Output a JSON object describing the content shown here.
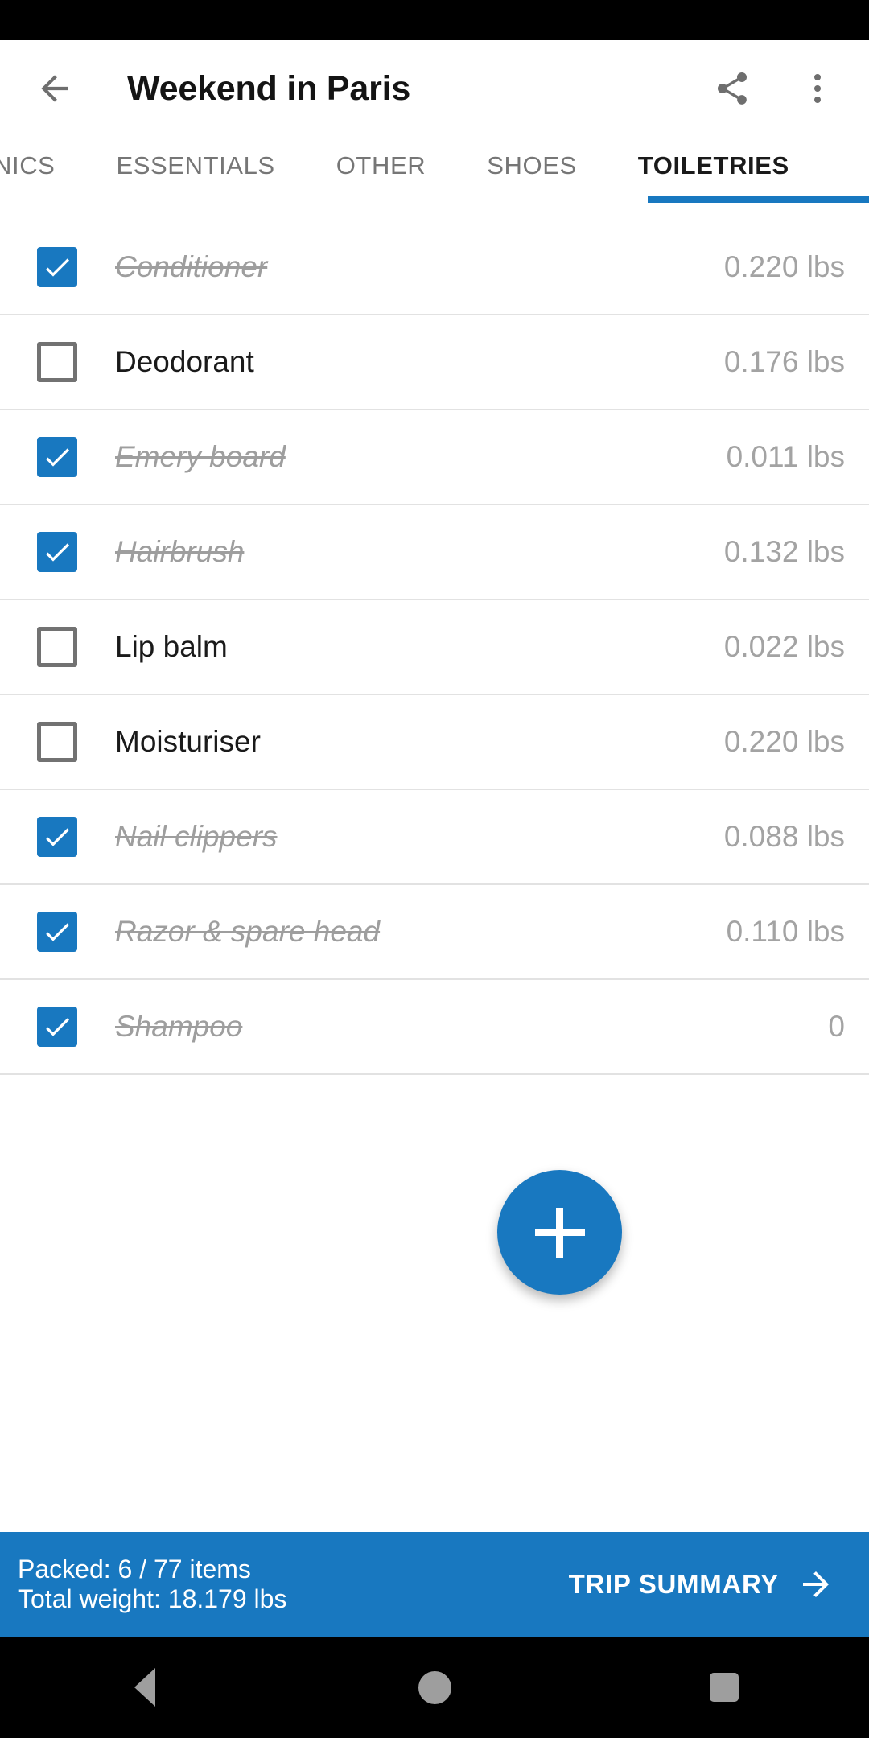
{
  "status_bar": {
    "background": "#000000"
  },
  "app_bar": {
    "back_icon": "arrow-left-icon",
    "title": "Weekend in Paris",
    "share_icon": "share-icon",
    "overflow_icon": "more-vertical-icon"
  },
  "tabs": {
    "items": [
      {
        "label": "NICS",
        "active": false
      },
      {
        "label": "ESSENTIALS",
        "active": false
      },
      {
        "label": "OTHER",
        "active": false
      },
      {
        "label": "SHOES",
        "active": false
      },
      {
        "label": "TOILETRIES",
        "active": true
      }
    ],
    "indicator_color": "#1878c0"
  },
  "list": {
    "items": [
      {
        "name": "Conditioner",
        "weight": "0.220 lbs",
        "packed": true
      },
      {
        "name": "Deodorant",
        "weight": "0.176 lbs",
        "packed": false
      },
      {
        "name": "Emery board",
        "weight": "0.011 lbs",
        "packed": true
      },
      {
        "name": "Hairbrush",
        "weight": "0.132 lbs",
        "packed": true
      },
      {
        "name": "Lip balm",
        "weight": "0.022 lbs",
        "packed": false
      },
      {
        "name": "Moisturiser",
        "weight": "0.220 lbs",
        "packed": false
      },
      {
        "name": "Nail clippers",
        "weight": "0.088 lbs",
        "packed": true
      },
      {
        "name": "Razor & spare head",
        "weight": "0.110 lbs",
        "packed": true
      },
      {
        "name": "Shampoo",
        "weight": "0",
        "packed": true
      }
    ]
  },
  "fab": {
    "icon": "plus-icon",
    "color": "#1878c0"
  },
  "summary_bar": {
    "packed_text": "Packed: 6 / 77 items",
    "weight_text": "Total weight: 18.179 lbs",
    "action_label": "TRIP SUMMARY",
    "action_icon": "arrow-right-icon",
    "background": "#1878c0"
  },
  "nav_bar": {
    "back_icon": "nav-back-triangle-icon",
    "home_icon": "nav-home-circle-icon",
    "recents_icon": "nav-recents-square-icon"
  }
}
